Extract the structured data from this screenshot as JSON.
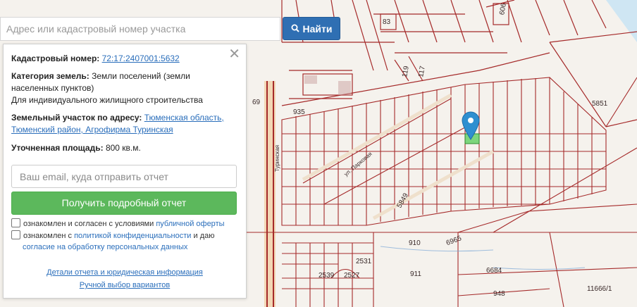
{
  "search": {
    "placeholder": "Адрес или кадастровый номер участка",
    "button_label": "Найти",
    "button_icon": "search-icon"
  },
  "info": {
    "cadastral_label": "Кадастровый номер:",
    "cadastral_value": "72:17:2407001:5632",
    "category_label": "Категория земель:",
    "category_value": "Земли поселений (земли населенных пунктов)",
    "usage_value": "Для индивидуального жилищного строительства",
    "address_label": "Земельный участок по адресу:",
    "address_value": "Тюменская область, Тюменский район, Агрофирма Туринская",
    "area_label": "Уточненная площадь:",
    "area_value": "800 кв.м."
  },
  "form": {
    "email_placeholder": "Ваш email, куда отправить отчет",
    "submit_label": "Получить подробный отчет",
    "consent1_prefix": "ознакомлен и согласен с условиями",
    "consent1_link": "публичной оферты",
    "consent2_prefix": "ознакомлен с",
    "consent2_link": "политикой конфиденциальности",
    "consent2_mid": "и даю",
    "consent2_link2": "согласие на обработку персональных данных"
  },
  "links": {
    "details": "Детали отчета и юридическая информация",
    "manual": "Ручной выбор вариантов"
  },
  "map": {
    "labels": [
      "83",
      "606",
      "119",
      "117",
      "5851",
      "935",
      "69",
      "5849",
      "910",
      "6965",
      "911",
      "6684",
      "2531",
      "2539",
      "2527",
      "948",
      "11666/1",
      "ул. Парковая",
      "Туринская"
    ],
    "colors": {
      "boundary": "#a52a2a",
      "selected_parcel": "#7dd67d",
      "marker": "#2f8fd0",
      "road": "#e8b98e"
    }
  }
}
